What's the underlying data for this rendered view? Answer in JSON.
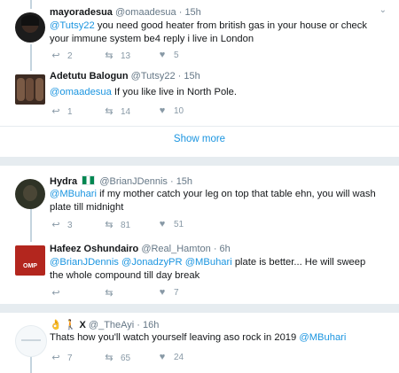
{
  "thread1": {
    "tweets": [
      {
        "name": "mayoradesua",
        "handle": "@omaadesua",
        "time": "· 15h",
        "text_mention": "@Tutsy22",
        "text_rest": " you need good heater from british gas in your house or check your immune system be4 reply i live in London",
        "reply_count": "2",
        "retweet_count": "13",
        "like_count": "5"
      },
      {
        "name": "Adetutu Balogun",
        "handle": "@Tutsy22",
        "time": "· 15h",
        "text_mention": "@omaadesua",
        "text_rest": " If you like live in North Pole.",
        "reply_count": "1",
        "retweet_count": "14",
        "like_count": "10"
      }
    ],
    "show_more": "Show more"
  },
  "thread2": {
    "tweets": [
      {
        "name": "Hydra",
        "handle": "@BrianJDennis",
        "time": "· 15h",
        "text_mention": "@MBuhari",
        "text_rest": " if my mother catch your leg on top that table ehn, you will wash plate till midnight",
        "reply_count": "3",
        "retweet_count": "81",
        "like_count": "51"
      },
      {
        "name": "Hafeez Oshundairo",
        "handle": "@Real_Hamton",
        "time": "· 6h",
        "text_mentions": [
          "@BrianJDennis",
          "@JonadzyPR",
          "@MBuhari"
        ],
        "text_rest": " plate is better... He will sweep the whole compound till day break",
        "reply_count": "",
        "retweet_count": "",
        "like_count": "7",
        "avatar_text": "OMP"
      }
    ]
  },
  "thread3": {
    "tweets": [
      {
        "name_prefix": "👌 🚶 X",
        "handle": "@_TheAyi",
        "time": "· 16h",
        "text_rest": "Thats how you'll watch yourself leaving aso rock in 2019 ",
        "text_mention": "@MBuhari",
        "reply_count": "7",
        "retweet_count": "65",
        "like_count": "24"
      }
    ]
  },
  "icons": {
    "reply": "reply-icon",
    "retweet": "retweet-icon",
    "like": "heart-icon",
    "caret": "chevron-down-icon"
  },
  "colors": {
    "link": "#1b95e0",
    "muted": "#8899a6",
    "thread_line": "#c4d4de",
    "background": "#e6ecf0"
  }
}
